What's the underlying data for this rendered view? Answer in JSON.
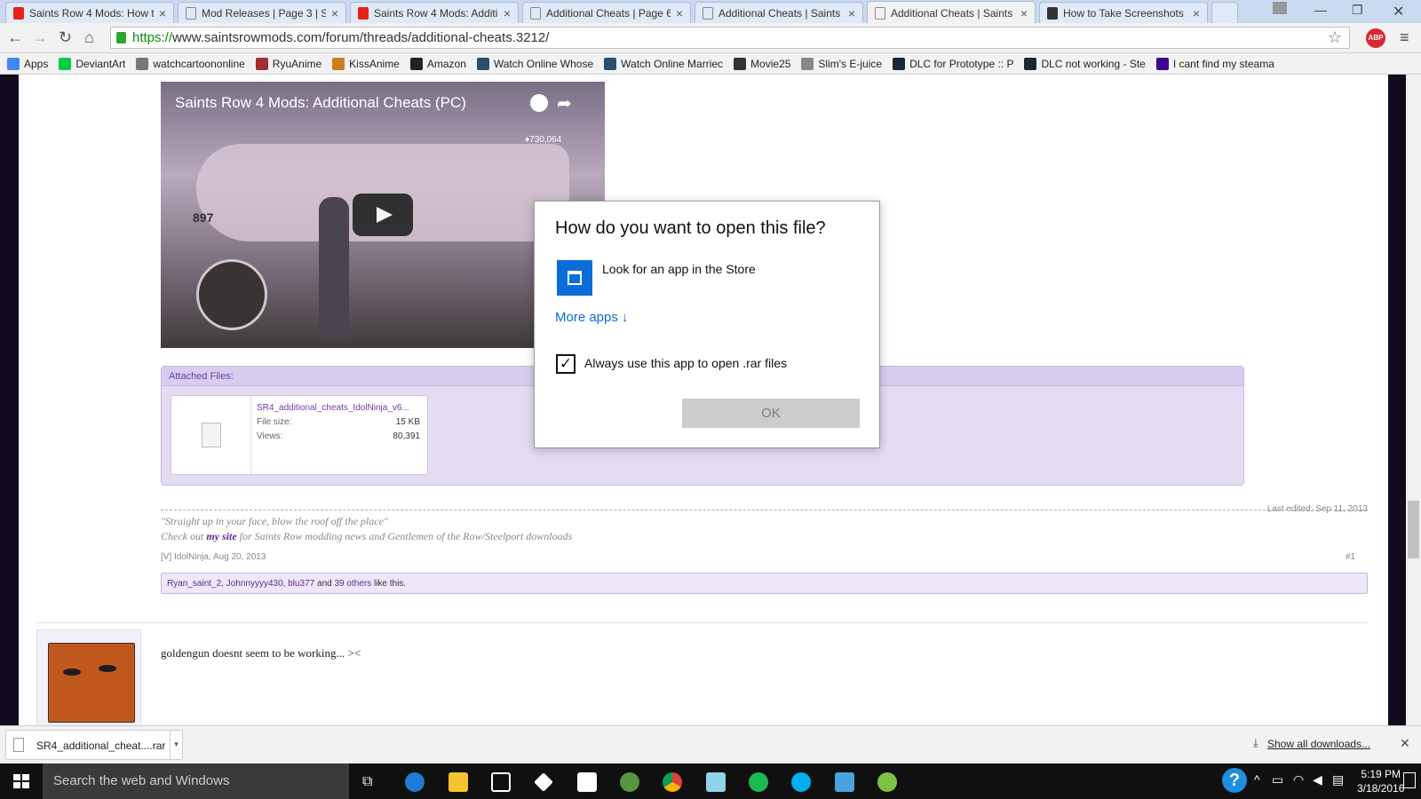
{
  "browser": {
    "tabs": [
      {
        "label": "Saints Row 4 Mods: How t",
        "icon": "youtube-icon",
        "color": "#e62117"
      },
      {
        "label": "Mod Releases | Page 3 | Sa",
        "icon": "page-icon",
        "color": "#888888"
      },
      {
        "label": "Saints Row 4 Mods: Additi",
        "icon": "youtube-icon",
        "color": "#e62117"
      },
      {
        "label": "Additional Cheats | Page 6",
        "icon": "page-icon",
        "color": "#888888"
      },
      {
        "label": "Additional Cheats | Saints",
        "icon": "page-icon",
        "color": "#888888"
      },
      {
        "label": "Additional Cheats | Saints",
        "icon": "page-icon",
        "color": "#888888",
        "active": true
      },
      {
        "label": "How to Take Screenshots",
        "icon": "htg-icon",
        "color": "#333333"
      }
    ],
    "url_protocol": "https://",
    "url_rest": "www.saintsrowmods.com/forum/threads/additional-cheats.3212/",
    "abp_label": "ABP",
    "bookmarks": [
      {
        "label": "Apps",
        "color": "#4285f4"
      },
      {
        "label": "DeviantArt",
        "color": "#05cc47"
      },
      {
        "label": "watchcartoononline",
        "color": "#777777"
      },
      {
        "label": "RyuAnime",
        "color": "#a03030"
      },
      {
        "label": "KissAnime",
        "color": "#c97f1e"
      },
      {
        "label": "Amazon",
        "color": "#222222"
      },
      {
        "label": "Watch Online Whose",
        "color": "#2b4d6e"
      },
      {
        "label": "Watch Online Marriec",
        "color": "#2b4d6e"
      },
      {
        "label": "Movie25",
        "color": "#333333"
      },
      {
        "label": "Slim's E-juice",
        "color": "#888888"
      },
      {
        "label": "DLC for Prototype :: P",
        "color": "#1b2838"
      },
      {
        "label": "DLC not working - Ste",
        "color": "#1b2838"
      },
      {
        "label": "I cant find my steama",
        "color": "#400090"
      }
    ]
  },
  "video": {
    "title": "Saints Row 4 Mods: Additional Cheats (PC)",
    "counter": "♦730,064",
    "tail_number": "897"
  },
  "attachment": {
    "header": "Attached Files:",
    "filename": "SR4_additional_cheats_IdolNinja_v6...",
    "size_label": "File size:",
    "size_value": "15 KB",
    "views_label": "Views:",
    "views_value": "80,391"
  },
  "post": {
    "last_edited": "Last edited: Sep 11, 2013",
    "sig_quote": "\"Straight up in your face, blow the roof off the place\"",
    "sig_prefix": "Check out ",
    "sig_link": "my site",
    "sig_suffix": " for Saints Row modding news and Gentlemen of the Row/Steelport downloads",
    "meta": "[V] IdolNinja, Aug 20, 2013",
    "post_number": "#1",
    "likes_names": "Ryan_saint_2, Johnnyyyy430, blu377",
    "likes_and": " and ",
    "likes_others": "39 others",
    "likes_suffix": " like this.",
    "reply_text": "goldengun doesnt seem to be working... ><"
  },
  "dialog": {
    "question": "How do you want to open this file?",
    "store_label": "Look for an app in the Store",
    "more_apps": "More apps ↓",
    "always_use": "Always use this app to open .rar files",
    "always_checked": true,
    "ok_label": "OK"
  },
  "downloads": {
    "file": "SR4_additional_cheat....rar",
    "show_all": "Show all downloads..."
  },
  "taskbar": {
    "search_placeholder": "Search the web and Windows",
    "time": "5:19 PM",
    "date": "3/18/2016",
    "apps": [
      {
        "name": "edge-icon",
        "color": "#1e7bd6"
      },
      {
        "name": "file-explorer-icon",
        "color": "#f4c430"
      },
      {
        "name": "store-icon",
        "color": "#ffffff"
      },
      {
        "name": "dropbox-icon",
        "color": "#ffffff"
      },
      {
        "name": "amazon-icon",
        "color": "#ffffff"
      },
      {
        "name": "tripadvisor-icon",
        "color": "#589442"
      },
      {
        "name": "chrome-icon",
        "color": "#db4437"
      },
      {
        "name": "notes-icon",
        "color": "#8fd3e8"
      },
      {
        "name": "spotify-icon",
        "color": "#1db954"
      },
      {
        "name": "skype-icon",
        "color": "#00aff0"
      },
      {
        "name": "remote-desktop-icon",
        "color": "#4aa3df"
      },
      {
        "name": "w-app-icon",
        "color": "#7cc142"
      }
    ]
  }
}
